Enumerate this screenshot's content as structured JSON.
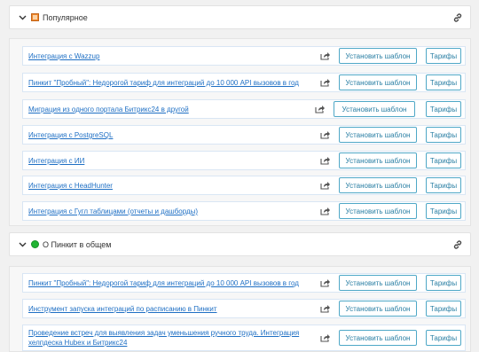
{
  "sections": [
    {
      "title": "Популярное",
      "icon": "orange-square-icon",
      "rows": [
        {
          "title": "Интеграция с Wazzup"
        },
        {
          "title": "Пинкит \"Пробный\": Недорогой тариф для интеграций до 10 000 API вызовов в год"
        },
        {
          "title": "Миграция из одного портала Битрикс24 в другой"
        },
        {
          "title": "Интеграция с PostgreSQL"
        },
        {
          "title": "Интеграция с ИИ"
        },
        {
          "title": "Интеграция с HeadHunter"
        },
        {
          "title": "Интеграция с Гугл таблицами (отчеты и дашборды)"
        }
      ]
    },
    {
      "title": "О Пинкит в общем",
      "icon": "green-circle-icon",
      "rows": [
        {
          "title": "Пинкит \"Пробный\": Недорогой тариф для интеграций до 10 000 API вызовов в год"
        },
        {
          "title": "Инструмент запуска интеграций по расписанию в Пинкит"
        },
        {
          "title": "Проведение встреч для выявления задач уменьшения ручного труда. Интеграция хелпдеска Hubex и Битрикс24"
        }
      ]
    }
  ],
  "labels": {
    "install": "Установить шаблон",
    "tariffs": "Тарифы"
  }
}
